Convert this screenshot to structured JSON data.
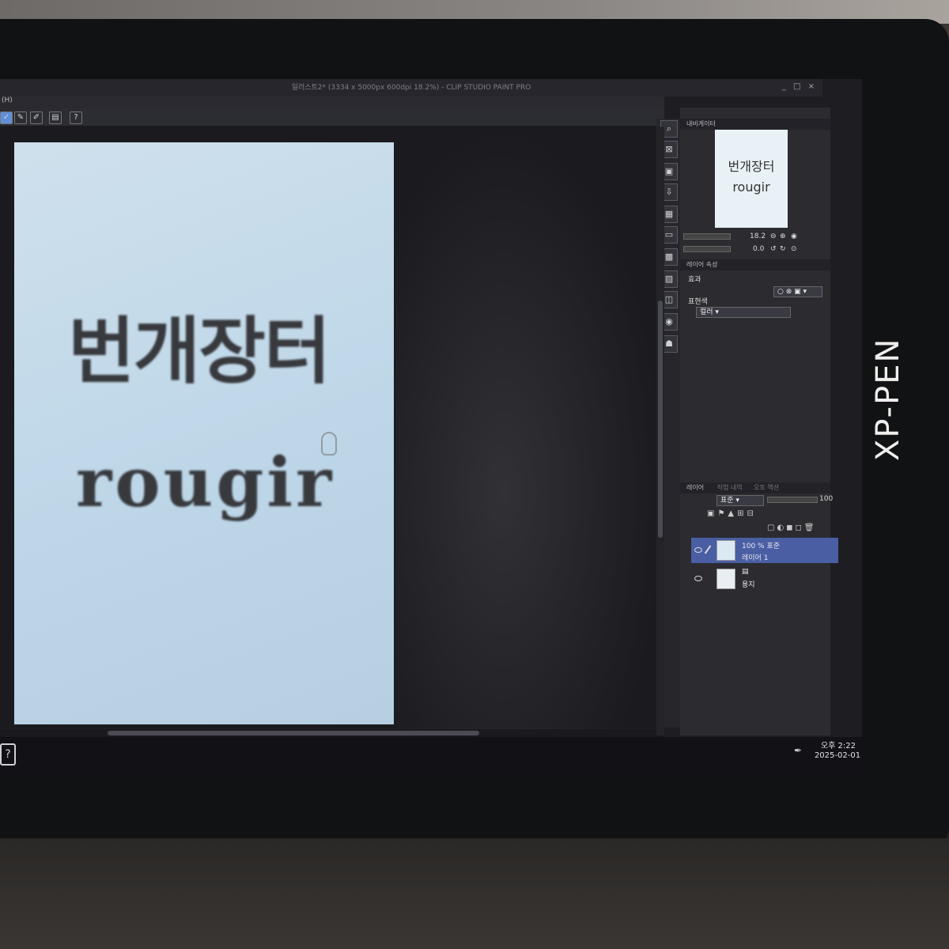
{
  "device": {
    "brand": "XP-PEN"
  },
  "window": {
    "title": "일러스트2* (3334 x 5000px 600dpi 18.2%) - CLIP STUDIO PAINT PRO",
    "menu_fragment": "(H)",
    "controls": [
      "_",
      "□",
      "×"
    ]
  },
  "toolbar": {
    "icons": [
      "check-icon",
      "brush-icon",
      "pen-icon",
      "document-icon",
      "help-icon"
    ]
  },
  "canvas": {
    "drawn_text_korean": "번개장터",
    "drawn_text_latin": "rougir"
  },
  "navigator": {
    "tab_label": "내비게이터",
    "thumb_line1": "번개장터",
    "thumb_line2": "rougir",
    "zoom_value": "18.2",
    "rotate_value": "0.0"
  },
  "layer_properties": {
    "tab_label": "레이어 속성",
    "effect_label": "효과",
    "expression_color_label": "표현색",
    "expression_color_value": "컬러"
  },
  "layers": {
    "tab_label": "레이어",
    "tab2_label": "작업 내역",
    "tab3_label": "오토 액션",
    "blend_mode": "표준",
    "opacity": "100",
    "items": [
      {
        "line1": "100 % 표준",
        "line2": "레이어 1",
        "selected": true
      },
      {
        "line1": "",
        "line2": "용지",
        "selected": false
      }
    ]
  },
  "taskbar": {
    "time": "오후 2:22",
    "date": "2025-02-01"
  }
}
